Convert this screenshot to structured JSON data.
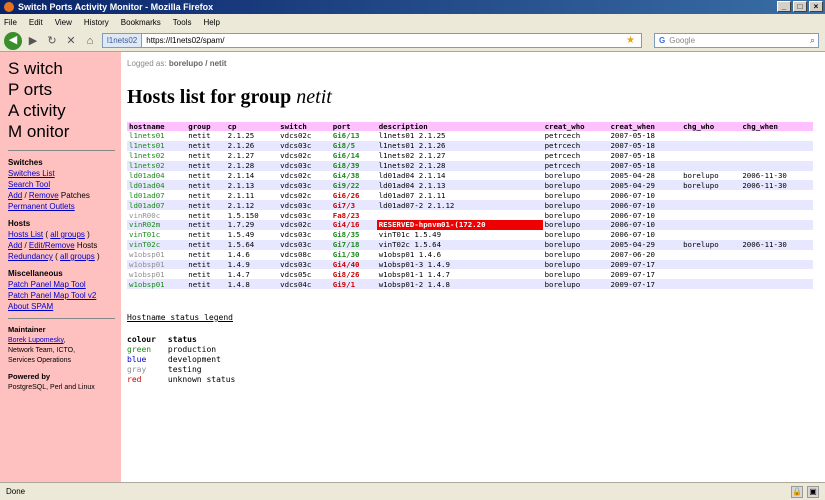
{
  "window": {
    "title": "Switch Ports Activity Monitor - Mozilla Firefox"
  },
  "menu": [
    "File",
    "Edit",
    "View",
    "History",
    "Bookmarks",
    "Tools",
    "Help"
  ],
  "nav": {
    "site": "l1nets02",
    "url": "https://l1nets02/spam/",
    "search_placeholder": "Google"
  },
  "sidebar": {
    "logo": [
      "S witch",
      "P orts",
      "A ctivity",
      "M onitor"
    ],
    "switches_title": "Switches",
    "switches_list": "Switches List",
    "search_tool": "Search Tool",
    "add": "Add",
    "slash1": " / ",
    "remove": "Remove",
    "patches": " Patches",
    "permanent_outlets": "Permanent Outlets",
    "hosts_title": "Hosts",
    "hosts_list": "Hosts List",
    "all_groups": "all groups",
    "add2": "Add",
    "edit_remove": "Edit/Remove",
    "hosts_word": " Hosts",
    "redundancy": "Redundancy",
    "misc_title": "Miscellaneous",
    "ppmt": "Patch Panel Map Tool",
    "ppmt2": "Patch Panel Map Tool v2",
    "about": "About SPAM",
    "maint_title": "Maintainer",
    "maint_name": "Borek Lupomesky",
    "maint_team": "Network Team, ICTO,",
    "maint_ops": "Services Operations",
    "powered_title": "Powered by",
    "powered": "PostgreSQL, Perl and Linux"
  },
  "main": {
    "logged_label": "Logged as: ",
    "logged_user": "borelupo / netit",
    "heading": "Hosts list for group ",
    "heading_group": "netit",
    "columns": [
      "hostname",
      "group",
      "cp",
      "switch",
      "port",
      "description",
      "creat_who",
      "creat_when",
      "chg_who",
      "chg_when"
    ],
    "rows": [
      {
        "hostname": "l1nets01",
        "color": "green",
        "group": "netit",
        "cp": "2.1.25",
        "switch": "vdcs02c",
        "port": "Gi6/13",
        "pcolor": "green",
        "description": "l1nets01 2.1.25",
        "creat_who": "petrcech",
        "creat_when": "2007-05-18",
        "chg_who": "",
        "chg_when": ""
      },
      {
        "hostname": "l1nets01",
        "color": "green",
        "group": "netit",
        "cp": "2.1.26",
        "switch": "vdcs03c",
        "port": "Gi8/5",
        "pcolor": "green",
        "description": "l1nets01 2.1.26",
        "creat_who": "petrcech",
        "creat_when": "2007-05-18",
        "chg_who": "",
        "chg_when": ""
      },
      {
        "hostname": "l1nets02",
        "color": "green",
        "group": "netit",
        "cp": "2.1.27",
        "switch": "vdcs02c",
        "port": "Gi6/14",
        "pcolor": "green",
        "description": "l1nets02 2.1.27",
        "creat_who": "petrcech",
        "creat_when": "2007-05-18",
        "chg_who": "",
        "chg_when": ""
      },
      {
        "hostname": "l1nets02",
        "color": "green",
        "group": "netit",
        "cp": "2.1.28",
        "switch": "vdcs03c",
        "port": "Gi8/39",
        "pcolor": "green",
        "description": "l1nets02 2.1.28",
        "creat_who": "petrcech",
        "creat_when": "2007-05-18",
        "chg_who": "",
        "chg_when": ""
      },
      {
        "hostname": "ld01ad04",
        "color": "green",
        "group": "netit",
        "cp": "2.1.14",
        "switch": "vdcs02c",
        "port": "Gi4/38",
        "pcolor": "green",
        "description": "ld01ad04 2.1.14",
        "creat_who": "borelupo",
        "creat_when": "2005-04-28",
        "chg_who": "borelupo",
        "chg_when": "2006-11-30"
      },
      {
        "hostname": "ld01ad04",
        "color": "green",
        "group": "netit",
        "cp": "2.1.13",
        "switch": "vdcs03c",
        "port": "Gi9/22",
        "pcolor": "green",
        "description": "ld01ad04 2.1.13",
        "creat_who": "borelupo",
        "creat_when": "2005-04-29",
        "chg_who": "borelupo",
        "chg_when": "2006-11-30"
      },
      {
        "hostname": "ld01ad07",
        "color": "green",
        "group": "netit",
        "cp": "2.1.11",
        "switch": "vdcs02c",
        "port": "Gi6/26",
        "pcolor": "red",
        "description": "ld01ad07 2.1.11",
        "creat_who": "borelupo",
        "creat_when": "2006-07-10",
        "chg_who": "",
        "chg_when": ""
      },
      {
        "hostname": "ld01ad07",
        "color": "green",
        "group": "netit",
        "cp": "2.1.12",
        "switch": "vdcs03c",
        "port": "Gi7/3",
        "pcolor": "red",
        "description": "ld01ad07-2 2.1.12",
        "creat_who": "borelupo",
        "creat_when": "2006-07-10",
        "chg_who": "",
        "chg_when": ""
      },
      {
        "hostname": "vinR00c",
        "color": "gray",
        "group": "netit",
        "cp": "1.5.150",
        "switch": "vdcs03c",
        "port": "Fa8/23",
        "pcolor": "red",
        "description": "",
        "creat_who": "borelupo",
        "creat_when": "2006-07-10",
        "chg_who": "",
        "chg_when": ""
      },
      {
        "hostname": "vinR02m",
        "color": "green",
        "group": "netit",
        "cp": "1.7.29",
        "switch": "vdcs02c",
        "port": "Gi4/16",
        "pcolor": "red",
        "description": "RESERVED-hpnvm01-(172.20",
        "reserved": true,
        "creat_who": "borelupo",
        "creat_when": "2006-07-10",
        "chg_who": "",
        "chg_when": ""
      },
      {
        "hostname": "vinT01c",
        "color": "green",
        "group": "netit",
        "cp": "1.5.49",
        "switch": "vdcs03c",
        "port": "Gi8/35",
        "pcolor": "green",
        "description": "vinT01c 1.5.49",
        "creat_who": "borelupo",
        "creat_when": "2006-07-10",
        "chg_who": "",
        "chg_when": ""
      },
      {
        "hostname": "vinT02c",
        "color": "green",
        "group": "netit",
        "cp": "1.5.64",
        "switch": "vdcs03c",
        "port": "Gi7/18",
        "pcolor": "green",
        "description": "vinT02c 1.5.64",
        "creat_who": "borelupo",
        "creat_when": "2005-04-29",
        "chg_who": "borelupo",
        "chg_when": "2006-11-30"
      },
      {
        "hostname": "w1obsp01",
        "color": "gray",
        "group": "netit",
        "cp": "1.4.6",
        "switch": "vdcs08c",
        "port": "Gi1/30",
        "pcolor": "green",
        "description": "w1obsp01 1.4.6",
        "creat_who": "borelupo",
        "creat_when": "2007-06-20",
        "chg_who": "",
        "chg_when": ""
      },
      {
        "hostname": "w1obsp01",
        "color": "gray",
        "group": "netit",
        "cp": "1.4.9",
        "switch": "vdcs03c",
        "port": "Gi4/40",
        "pcolor": "red",
        "description": "w1obsp01-3 1.4.9",
        "creat_who": "borelupo",
        "creat_when": "2009-07-17",
        "chg_who": "",
        "chg_when": ""
      },
      {
        "hostname": "w1obsp01",
        "color": "gray",
        "group": "netit",
        "cp": "1.4.7",
        "switch": "vdcs05c",
        "port": "Gi8/26",
        "pcolor": "red",
        "description": "w1obsp01-1 1.4.7",
        "creat_who": "borelupo",
        "creat_when": "2009-07-17",
        "chg_who": "",
        "chg_when": ""
      },
      {
        "hostname": "w1obsp01",
        "color": "green",
        "group": "netit",
        "cp": "1.4.8",
        "switch": "vdcs04c",
        "port": "Gi9/1",
        "pcolor": "red",
        "description": "w1obsp01-2 1.4.8",
        "creat_who": "borelupo",
        "creat_when": "2009-07-17",
        "chg_who": "",
        "chg_when": ""
      }
    ],
    "legend_title": "Hostname status legend",
    "legend_headers": [
      "colour",
      "status"
    ],
    "legend": [
      {
        "colour": "green",
        "status": "production",
        "color": "green"
      },
      {
        "colour": "blue",
        "status": "development",
        "color": "blue"
      },
      {
        "colour": "gray",
        "status": "testing",
        "color": "gray"
      },
      {
        "colour": "red",
        "status": "unknown status",
        "color": "red"
      }
    ]
  },
  "status": {
    "text": "Done"
  }
}
